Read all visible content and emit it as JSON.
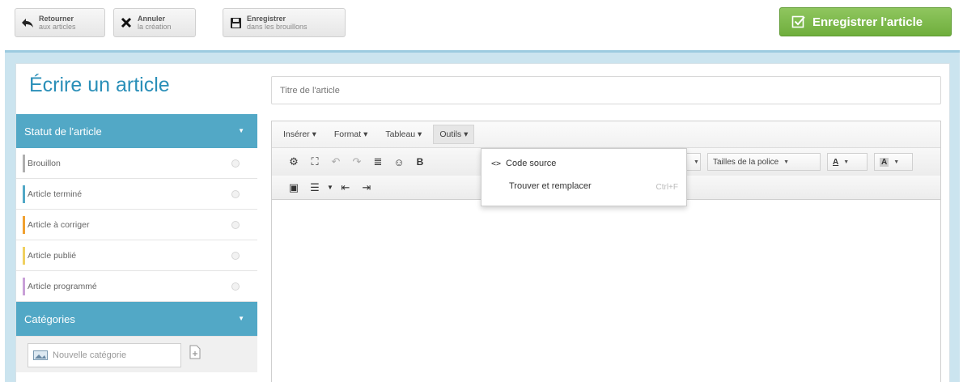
{
  "toolbar": {
    "back": {
      "line1": "Retourner",
      "line2": "aux articles",
      "icon": "back-arrow-icon"
    },
    "cancel": {
      "line1": "Annuler",
      "line2": "la création",
      "icon": "close-icon"
    },
    "draft": {
      "line1": "Enregistrer",
      "line2": "dans les brouillons",
      "icon": "floppy-icon"
    },
    "publish": {
      "label": "Enregistrer l'article",
      "icon": "check-square-icon",
      "color": "#7ab84a"
    }
  },
  "page": {
    "title": "Écrire un article",
    "title_placeholder": "Titre de l'article"
  },
  "sidebar": {
    "status_header": "Statut de l'article",
    "statuses": [
      {
        "label": "Brouillon",
        "color": "#b0b0b0"
      },
      {
        "label": "Article terminé",
        "color": "#52a8c6"
      },
      {
        "label": "Article à corriger",
        "color": "#f0a030"
      },
      {
        "label": "Article publié",
        "color": "#f0d060"
      },
      {
        "label": "Article programmé",
        "color": "#c9a0d8"
      }
    ],
    "categories_header": "Catégories",
    "new_category_placeholder": "Nouvelle catégorie"
  },
  "editor": {
    "menus": [
      "Insérer",
      "Format",
      "Tableau",
      "Outils"
    ],
    "active_menu": "Outils",
    "font_sizes_label": "Tailles de la police",
    "dropdown": {
      "items": [
        {
          "label": "Code source",
          "icon": "code-icon"
        },
        {
          "label": "Trouver et remplacer",
          "shortcut": "Ctrl+F"
        }
      ]
    }
  },
  "colors": {
    "accent": "#52a8c6",
    "panel_bg": "#cbe4ef",
    "title": "#2a8fb8"
  }
}
